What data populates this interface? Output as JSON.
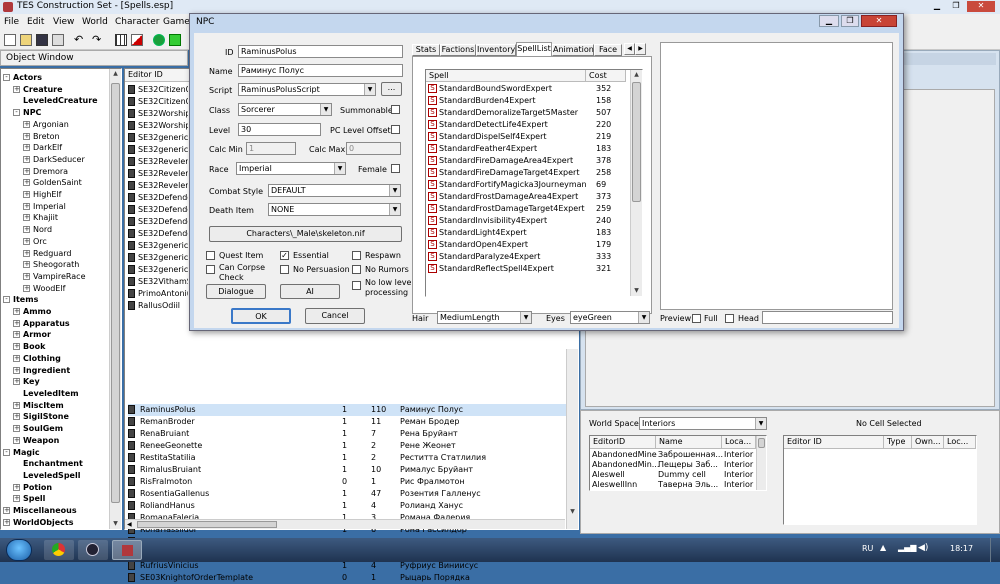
{
  "app": {
    "title": "TES Construction Set - [Spells.esp]",
    "menu": [
      "File",
      "Edit",
      "View",
      "World",
      "Character",
      "Game"
    ]
  },
  "object_window": {
    "title": "Object Window",
    "tree": [
      {
        "label": "Actors",
        "level": 0,
        "exp": "-",
        "bold": true
      },
      {
        "label": "Creature",
        "level": 1,
        "exp": "+",
        "bold": true
      },
      {
        "label": "LeveledCreature",
        "level": 1,
        "exp": "",
        "bold": true
      },
      {
        "label": "NPC",
        "level": 1,
        "exp": "-",
        "bold": true
      },
      {
        "label": "Argonian",
        "level": 2,
        "exp": "+"
      },
      {
        "label": "Breton",
        "level": 2,
        "exp": "+"
      },
      {
        "label": "DarkElf",
        "level": 2,
        "exp": "+"
      },
      {
        "label": "DarkSeducer",
        "level": 2,
        "exp": "+"
      },
      {
        "label": "Dremora",
        "level": 2,
        "exp": "+"
      },
      {
        "label": "GoldenSaint",
        "level": 2,
        "exp": "+"
      },
      {
        "label": "HighElf",
        "level": 2,
        "exp": "+"
      },
      {
        "label": "Imperial",
        "level": 2,
        "exp": "+"
      },
      {
        "label": "Khajiit",
        "level": 2,
        "exp": "+"
      },
      {
        "label": "Nord",
        "level": 2,
        "exp": "+"
      },
      {
        "label": "Orc",
        "level": 2,
        "exp": "+"
      },
      {
        "label": "Redguard",
        "level": 2,
        "exp": "+"
      },
      {
        "label": "Sheogorath",
        "level": 2,
        "exp": "+"
      },
      {
        "label": "VampireRace",
        "level": 2,
        "exp": "+"
      },
      {
        "label": "WoodElf",
        "level": 2,
        "exp": "+"
      },
      {
        "label": "Items",
        "level": 0,
        "exp": "-",
        "bold": true
      },
      {
        "label": "Ammo",
        "level": 1,
        "exp": "+",
        "bold": true
      },
      {
        "label": "Apparatus",
        "level": 1,
        "exp": "+",
        "bold": true
      },
      {
        "label": "Armor",
        "level": 1,
        "exp": "+",
        "bold": true
      },
      {
        "label": "Book",
        "level": 1,
        "exp": "+",
        "bold": true
      },
      {
        "label": "Clothing",
        "level": 1,
        "exp": "+",
        "bold": true
      },
      {
        "label": "Ingredient",
        "level": 1,
        "exp": "+",
        "bold": true
      },
      {
        "label": "Key",
        "level": 1,
        "exp": "+",
        "bold": true
      },
      {
        "label": "LeveledItem",
        "level": 1,
        "exp": "",
        "bold": true
      },
      {
        "label": "MiscItem",
        "level": 1,
        "exp": "+",
        "bold": true
      },
      {
        "label": "SigilStone",
        "level": 1,
        "exp": "+",
        "bold": true
      },
      {
        "label": "SoulGem",
        "level": 1,
        "exp": "+",
        "bold": true
      },
      {
        "label": "Weapon",
        "level": 1,
        "exp": "+",
        "bold": true
      },
      {
        "label": "Magic",
        "level": 0,
        "exp": "-",
        "bold": true
      },
      {
        "label": "Enchantment",
        "level": 1,
        "exp": "",
        "bold": true
      },
      {
        "label": "LeveledSpell",
        "level": 1,
        "exp": "",
        "bold": true
      },
      {
        "label": "Potion",
        "level": 1,
        "exp": "+",
        "bold": true
      },
      {
        "label": "Spell",
        "level": 1,
        "exp": "+",
        "bold": true
      },
      {
        "label": "Miscellaneous",
        "level": 0,
        "exp": "+",
        "bold": true
      },
      {
        "label": "WorldObjects",
        "level": 0,
        "exp": "+",
        "bold": true
      }
    ],
    "list_header": "Editor ID",
    "hidden_ids": [
      "SE32Citizen01",
      "SE32Citizen02",
      "SE32Worship",
      "SE32Worship",
      "SE32genericD",
      "SE32genericD",
      "SE32Reveler",
      "SE32Reveler",
      "SE32Reveler",
      "SE32Defende",
      "SE32Defende",
      "SE32Defende",
      "SE32Defende",
      "SE32genericD",
      "SE32genericD",
      "SE32genericD",
      "SE32VithamS",
      "PrimoAntonius",
      "RallusOdiil"
    ],
    "rows": [
      [
        "RaminusPolus",
        "1",
        "110",
        "Раминус Полус"
      ],
      [
        "RemanBroder",
        "1",
        "11",
        "Реман Бродер"
      ],
      [
        "RenaBruiant",
        "1",
        "7",
        "Рена Бруйант"
      ],
      [
        "ReneeGeonette",
        "1",
        "2",
        "Рене Жеонет"
      ],
      [
        "RestitaStatilia",
        "1",
        "2",
        "Реститта Статлилия"
      ],
      [
        "RimalusBruiant",
        "1",
        "10",
        "Рималус Бруйант"
      ],
      [
        "RisFralmoton",
        "0",
        "1",
        "Рис Фралмотон"
      ],
      [
        "RosentiaGallenus",
        "1",
        "47",
        "Розентия Галленус"
      ],
      [
        "RoliandHanus",
        "1",
        "4",
        "Ролианд Ханус"
      ],
      [
        "RomanaFaleria",
        "1",
        "3",
        "Романа Фалерия"
      ],
      [
        "RonaHassildor",
        "1",
        "6",
        "Рона Гассилдор"
      ],
      [
        "FGC06DeadMiner1",
        "2",
        "0",
        "Рудокоп"
      ],
      [
        "RusiaBradus",
        "1",
        "15",
        "Русия Брадус"
      ],
      [
        "RufriusVinicius",
        "1",
        "4",
        "Руфриус Виниисус"
      ],
      [
        "SE03KnightofOrderTemplate",
        "0",
        "1",
        "Рыцарь Порядка"
      ]
    ]
  },
  "npc": {
    "title": "NPC",
    "id_label": "ID",
    "id": "RaminusPolus",
    "name_label": "Name",
    "name": "Раминус Полус",
    "script_label": "Script",
    "script": "RaminusPolusScript",
    "script_btn": "...",
    "class_label": "Class",
    "class": "Sorcerer",
    "summonable": "Summonable",
    "level_label": "Level",
    "level": "30",
    "pc_offset": "PC Level Offset",
    "calcmin_label": "Calc Min",
    "calcmin": "1",
    "calcmax_label": "Calc Max",
    "calcmax": "0",
    "race_label": "Race",
    "race": "Imperial",
    "female": "Female",
    "combat_label": "Combat Style",
    "combat": "DEFAULT",
    "death_label": "Death Item",
    "death": "NONE",
    "skeleton": "Characters\\_Male\\skeleton.nif",
    "flags": {
      "quest": "Quest Item",
      "essential": "Essential",
      "respawn": "Respawn",
      "corpse": "Can Corpse Check",
      "nopersuasion": "No Persuasion",
      "norumors": "No Rumors",
      "nolowlevel": "No low level processing"
    },
    "dialogue_btn": "Dialogue",
    "ai_btn": "AI",
    "ok_btn": "OK",
    "cancel_btn": "Cancel",
    "tabs": [
      "Stats",
      "Factions",
      "Inventory",
      "SpellList",
      "Animation",
      "Face"
    ],
    "spell_header": "Spell",
    "cost_header": "Cost",
    "spells": [
      [
        "StandardBoundSwordExpert",
        "352"
      ],
      [
        "StandardBurden4Expert",
        "158"
      ],
      [
        "StandardDemoralizeTarget5Master",
        "507"
      ],
      [
        "StandardDetectLife4Expert",
        "220"
      ],
      [
        "StandardDispelSelf4Expert",
        "219"
      ],
      [
        "StandardFeather4Expert",
        "183"
      ],
      [
        "StandardFireDamageArea4Expert",
        "378"
      ],
      [
        "StandardFireDamageTarget4Expert",
        "258"
      ],
      [
        "StandardFortifyMagicka3Journeyman",
        "69"
      ],
      [
        "StandardFrostDamageArea4Expert",
        "373"
      ],
      [
        "StandardFrostDamageTarget4Expert",
        "259"
      ],
      [
        "StandardInvisibility4Expert",
        "240"
      ],
      [
        "StandardLight4Expert",
        "183"
      ],
      [
        "StandardOpen4Expert",
        "179"
      ],
      [
        "StandardParalyze4Expert",
        "333"
      ],
      [
        "StandardReflectSpell4Expert",
        "321"
      ]
    ],
    "hair_label": "Hair",
    "hair": "MediumLength",
    "eyes_label": "Eyes",
    "eyes": "eyeGreen",
    "preview": "Preview",
    "full": "Full",
    "head": "Head"
  },
  "cell_view": {
    "worldspace_label": "World Space",
    "worldspace": "Interiors",
    "no_cell": "No Cell Selected",
    "cols": [
      "EditorID",
      "Name",
      "Loca..."
    ],
    "rows": [
      [
        "AbandonedMine",
        "Заброшенная...",
        "Interior"
      ],
      [
        "AbandonedMin...",
        "Пещеры Заб...",
        "Interior"
      ],
      [
        "Aleswell",
        "Dummy cell",
        "Interior"
      ],
      [
        "AleswellInn",
        "Таверна Эль...",
        "Interior"
      ]
    ],
    "ref_cols": [
      "Editor ID",
      "Type",
      "Own...",
      "Loc..."
    ]
  },
  "taskbar": {
    "lang": "RU",
    "time": "18:17"
  }
}
